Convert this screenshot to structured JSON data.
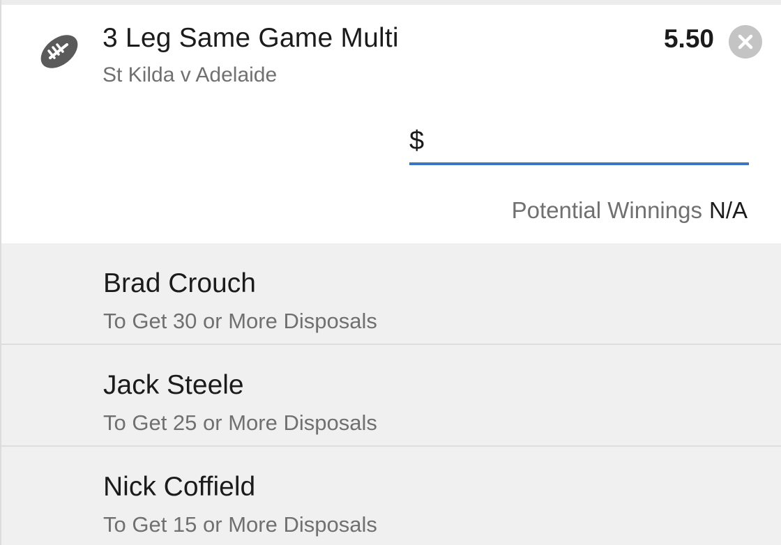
{
  "bet": {
    "title": "3 Leg Same Game Multi",
    "match": "St Kilda v Adelaide",
    "odds": "5.50",
    "sport_icon": "football-icon",
    "remove_icon": "close-circle-icon"
  },
  "stake": {
    "currency_symbol": "$",
    "value": ""
  },
  "winnings": {
    "label": "Potential Winnings",
    "value": "N/A"
  },
  "legs": [
    {
      "player": "Brad Crouch",
      "market": "To Get 30 or More Disposals"
    },
    {
      "player": "Jack Steele",
      "market": "To Get 25 or More Disposals"
    },
    {
      "player": "Nick Coffield",
      "market": "To Get 15 or More Disposals"
    }
  ],
  "colors": {
    "accent": "#3a76c4",
    "text_primary": "#1b1b1b",
    "text_secondary": "#707070",
    "legs_background": "#f0f0f0",
    "remove_button": "#c4c4c4"
  }
}
